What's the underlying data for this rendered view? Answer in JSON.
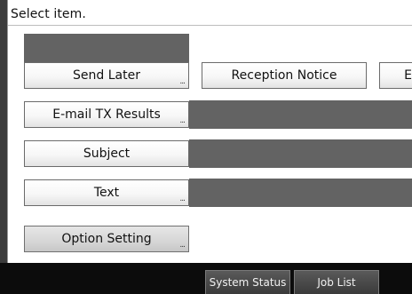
{
  "header": {
    "instruction": "Select item."
  },
  "buttons": {
    "send_later": "Send Later",
    "reception_notice": "Reception Notice",
    "partial_label": "E",
    "email_tx_results": "E-mail TX Results",
    "subject": "Subject",
    "text": "Text",
    "option_setting": "Option Setting"
  },
  "more_indicator": "...",
  "footer": {
    "system_status": "System Status",
    "job_list": "Job List"
  }
}
